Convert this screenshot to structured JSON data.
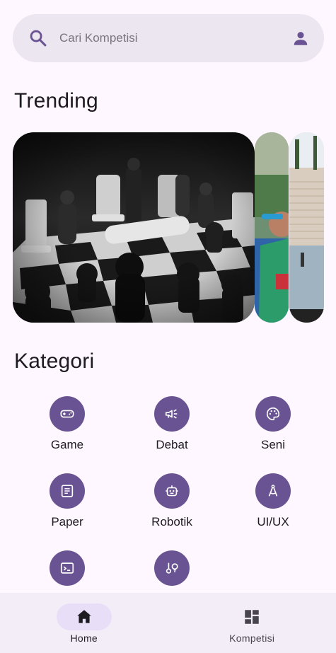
{
  "search": {
    "placeholder": "Cari Kompetisi",
    "icon": "search-icon",
    "profile_icon": "person-icon"
  },
  "trending": {
    "title": "Trending",
    "cards": [
      {
        "subject": "chess-board-photo"
      },
      {
        "subject": "athlete-photo"
      },
      {
        "subject": "stadium-photo"
      }
    ]
  },
  "kategori": {
    "title": "Kategori",
    "items": [
      {
        "label": "Game",
        "icon": "gamepad-icon"
      },
      {
        "label": "Debat",
        "icon": "megaphone-icon"
      },
      {
        "label": "Seni",
        "icon": "palette-icon"
      },
      {
        "label": "Paper",
        "icon": "document-icon"
      },
      {
        "label": "Robotik",
        "icon": "robot-icon"
      },
      {
        "label": "UI/UX",
        "icon": "compass-icon"
      },
      {
        "label": "",
        "icon": "terminal-icon"
      },
      {
        "label": "",
        "icon": "science-icon"
      }
    ]
  },
  "nav": {
    "items": [
      {
        "label": "Home",
        "icon": "home-icon",
        "active": true
      },
      {
        "label": "Kompetisi",
        "icon": "dashboard-icon",
        "active": false
      }
    ]
  },
  "colors": {
    "background": "#fef7ff",
    "accent": "#6a5393",
    "search_bg": "#ece6f0",
    "nav_bg": "#f3edf7",
    "active_pill": "#e8def8"
  }
}
